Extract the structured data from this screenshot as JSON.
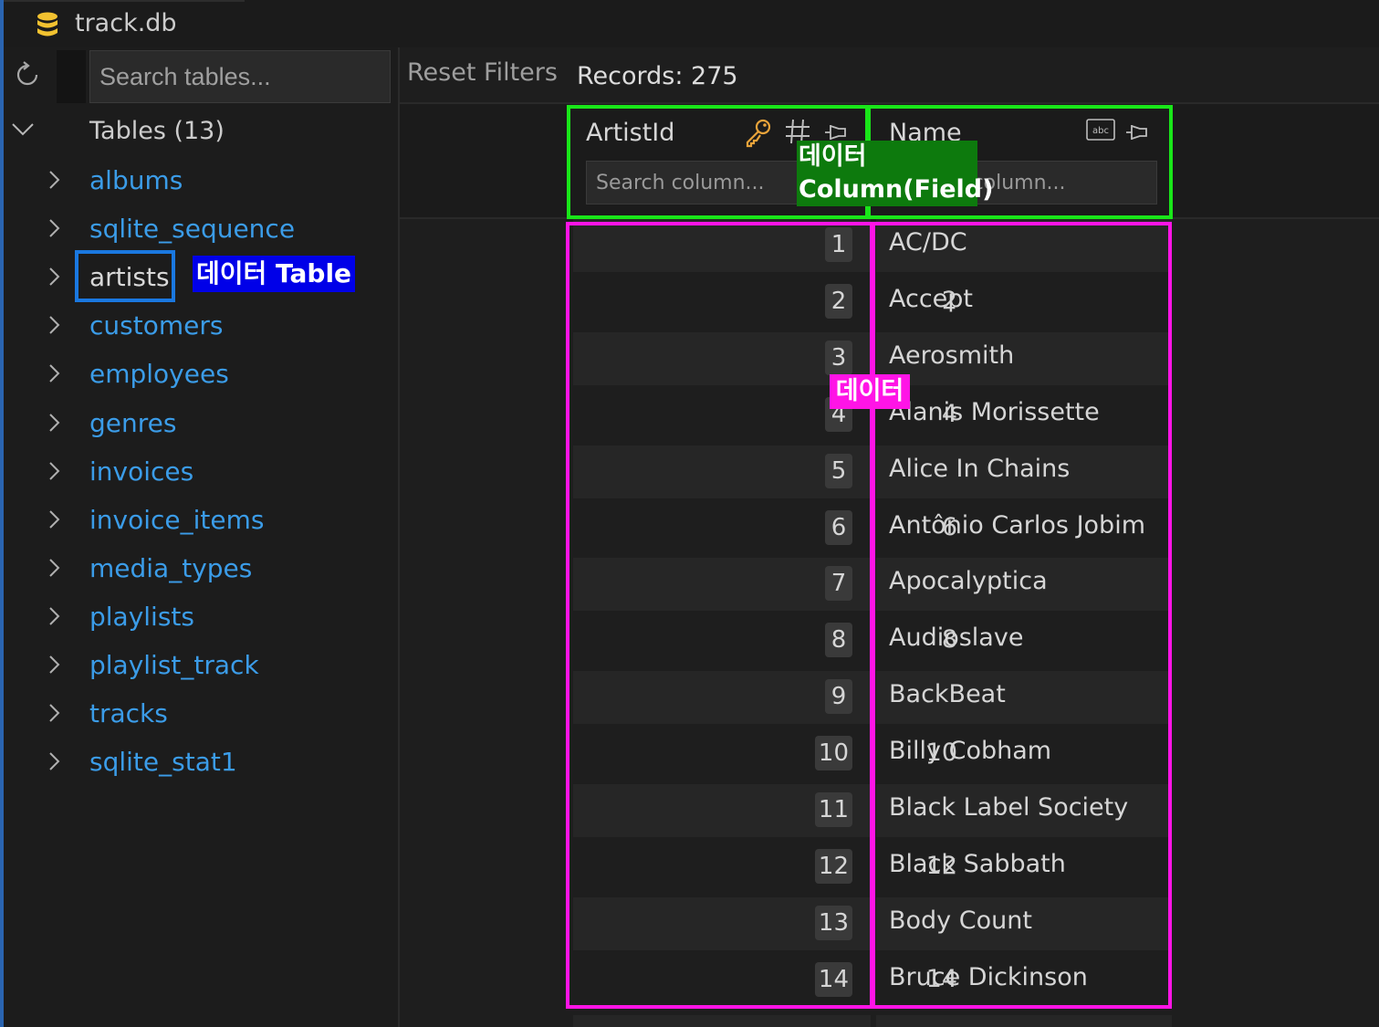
{
  "window": {
    "tab_title": "track.db"
  },
  "sidebar": {
    "search_placeholder": "Search tables...",
    "tables_header": "Tables (13)",
    "tables": [
      "albums",
      "sqlite_sequence",
      "artists",
      "customers",
      "employees",
      "genres",
      "invoices",
      "invoice_items",
      "media_types",
      "playlists",
      "playlist_track",
      "tracks",
      "sqlite_stat1"
    ],
    "selected_table": "artists"
  },
  "toolbar": {
    "reset_filters": "Reset Filters",
    "records": "Records: 275"
  },
  "columns": [
    {
      "name": "ArtistId",
      "filter_placeholder": "Search column...",
      "icons": [
        "key-icon",
        "number-type-icon",
        "pin-icon"
      ]
    },
    {
      "name": "Name",
      "filter_placeholder": "Search column...",
      "icons": [
        "text-type-icon",
        "pin-icon"
      ]
    }
  ],
  "rows": [
    {
      "n": "1",
      "id": "1",
      "name": "AC/DC"
    },
    {
      "n": "2",
      "id": "2",
      "name": "Accept"
    },
    {
      "n": "3",
      "id": "3",
      "name": "Aerosmith"
    },
    {
      "n": "4",
      "id": "4",
      "name": "Alanis Morissette"
    },
    {
      "n": "5",
      "id": "5",
      "name": "Alice In Chains"
    },
    {
      "n": "6",
      "id": "6",
      "name": "Antônio Carlos Jobim"
    },
    {
      "n": "7",
      "id": "7",
      "name": "Apocalyptica"
    },
    {
      "n": "8",
      "id": "8",
      "name": "Audioslave"
    },
    {
      "n": "9",
      "id": "9",
      "name": "BackBeat"
    },
    {
      "n": "10",
      "id": "10",
      "name": "Billy Cobham"
    },
    {
      "n": "11",
      "id": "11",
      "name": "Black Label Society"
    },
    {
      "n": "12",
      "id": "12",
      "name": "Black Sabbath"
    },
    {
      "n": "13",
      "id": "13",
      "name": "Body Count"
    },
    {
      "n": "14",
      "id": "14",
      "name": "Bruce Dickinson"
    }
  ],
  "annotations": {
    "table": "데이터 Table",
    "column_line1": "데이터",
    "column_line2": "Column(Field)",
    "data": "데이터"
  },
  "colors": {
    "table_annotation": "#0000e8",
    "column_annotation_outline": "#19e619",
    "data_annotation_outline": "#ff14e6",
    "table_link": "#3b9ce8",
    "key_icon": "#e8a33a"
  }
}
